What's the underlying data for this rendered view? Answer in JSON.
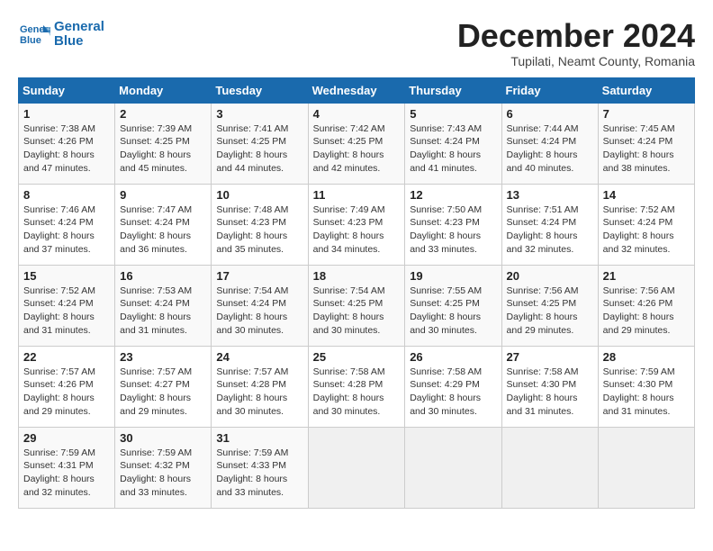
{
  "logo": {
    "line1": "General",
    "line2": "Blue"
  },
  "title": "December 2024",
  "location": "Tupilati, Neamt County, Romania",
  "weekdays": [
    "Sunday",
    "Monday",
    "Tuesday",
    "Wednesday",
    "Thursday",
    "Friday",
    "Saturday"
  ],
  "weeks": [
    [
      {
        "day": "1",
        "sunrise": "7:38 AM",
        "sunset": "4:26 PM",
        "daylight": "8 hours and 47 minutes."
      },
      {
        "day": "2",
        "sunrise": "7:39 AM",
        "sunset": "4:25 PM",
        "daylight": "8 hours and 45 minutes."
      },
      {
        "day": "3",
        "sunrise": "7:41 AM",
        "sunset": "4:25 PM",
        "daylight": "8 hours and 44 minutes."
      },
      {
        "day": "4",
        "sunrise": "7:42 AM",
        "sunset": "4:25 PM",
        "daylight": "8 hours and 42 minutes."
      },
      {
        "day": "5",
        "sunrise": "7:43 AM",
        "sunset": "4:24 PM",
        "daylight": "8 hours and 41 minutes."
      },
      {
        "day": "6",
        "sunrise": "7:44 AM",
        "sunset": "4:24 PM",
        "daylight": "8 hours and 40 minutes."
      },
      {
        "day": "7",
        "sunrise": "7:45 AM",
        "sunset": "4:24 PM",
        "daylight": "8 hours and 38 minutes."
      }
    ],
    [
      {
        "day": "8",
        "sunrise": "7:46 AM",
        "sunset": "4:24 PM",
        "daylight": "8 hours and 37 minutes."
      },
      {
        "day": "9",
        "sunrise": "7:47 AM",
        "sunset": "4:24 PM",
        "daylight": "8 hours and 36 minutes."
      },
      {
        "day": "10",
        "sunrise": "7:48 AM",
        "sunset": "4:23 PM",
        "daylight": "8 hours and 35 minutes."
      },
      {
        "day": "11",
        "sunrise": "7:49 AM",
        "sunset": "4:23 PM",
        "daylight": "8 hours and 34 minutes."
      },
      {
        "day": "12",
        "sunrise": "7:50 AM",
        "sunset": "4:23 PM",
        "daylight": "8 hours and 33 minutes."
      },
      {
        "day": "13",
        "sunrise": "7:51 AM",
        "sunset": "4:24 PM",
        "daylight": "8 hours and 32 minutes."
      },
      {
        "day": "14",
        "sunrise": "7:52 AM",
        "sunset": "4:24 PM",
        "daylight": "8 hours and 32 minutes."
      }
    ],
    [
      {
        "day": "15",
        "sunrise": "7:52 AM",
        "sunset": "4:24 PM",
        "daylight": "8 hours and 31 minutes."
      },
      {
        "day": "16",
        "sunrise": "7:53 AM",
        "sunset": "4:24 PM",
        "daylight": "8 hours and 31 minutes."
      },
      {
        "day": "17",
        "sunrise": "7:54 AM",
        "sunset": "4:24 PM",
        "daylight": "8 hours and 30 minutes."
      },
      {
        "day": "18",
        "sunrise": "7:54 AM",
        "sunset": "4:25 PM",
        "daylight": "8 hours and 30 minutes."
      },
      {
        "day": "19",
        "sunrise": "7:55 AM",
        "sunset": "4:25 PM",
        "daylight": "8 hours and 30 minutes."
      },
      {
        "day": "20",
        "sunrise": "7:56 AM",
        "sunset": "4:25 PM",
        "daylight": "8 hours and 29 minutes."
      },
      {
        "day": "21",
        "sunrise": "7:56 AM",
        "sunset": "4:26 PM",
        "daylight": "8 hours and 29 minutes."
      }
    ],
    [
      {
        "day": "22",
        "sunrise": "7:57 AM",
        "sunset": "4:26 PM",
        "daylight": "8 hours and 29 minutes."
      },
      {
        "day": "23",
        "sunrise": "7:57 AM",
        "sunset": "4:27 PM",
        "daylight": "8 hours and 29 minutes."
      },
      {
        "day": "24",
        "sunrise": "7:57 AM",
        "sunset": "4:28 PM",
        "daylight": "8 hours and 30 minutes."
      },
      {
        "day": "25",
        "sunrise": "7:58 AM",
        "sunset": "4:28 PM",
        "daylight": "8 hours and 30 minutes."
      },
      {
        "day": "26",
        "sunrise": "7:58 AM",
        "sunset": "4:29 PM",
        "daylight": "8 hours and 30 minutes."
      },
      {
        "day": "27",
        "sunrise": "7:58 AM",
        "sunset": "4:30 PM",
        "daylight": "8 hours and 31 minutes."
      },
      {
        "day": "28",
        "sunrise": "7:59 AM",
        "sunset": "4:30 PM",
        "daylight": "8 hours and 31 minutes."
      }
    ],
    [
      {
        "day": "29",
        "sunrise": "7:59 AM",
        "sunset": "4:31 PM",
        "daylight": "8 hours and 32 minutes."
      },
      {
        "day": "30",
        "sunrise": "7:59 AM",
        "sunset": "4:32 PM",
        "daylight": "8 hours and 33 minutes."
      },
      {
        "day": "31",
        "sunrise": "7:59 AM",
        "sunset": "4:33 PM",
        "daylight": "8 hours and 33 minutes."
      },
      null,
      null,
      null,
      null
    ]
  ]
}
